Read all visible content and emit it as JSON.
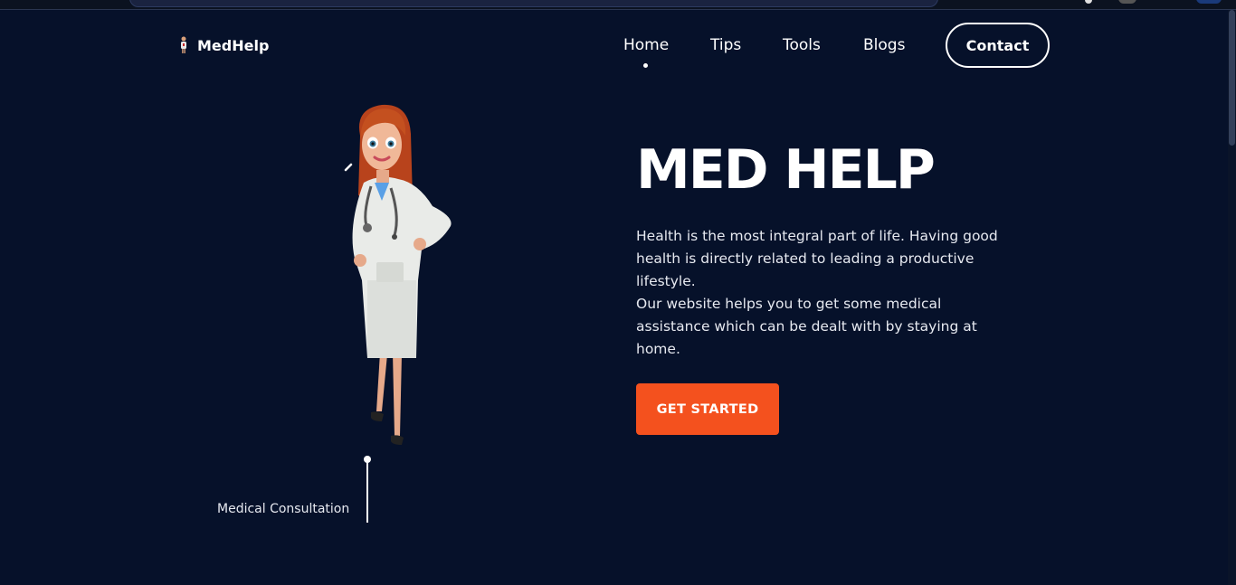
{
  "brand": {
    "name": "MedHelp"
  },
  "nav": {
    "items": [
      {
        "label": "Home"
      },
      {
        "label": "Tips"
      },
      {
        "label": "Tools"
      },
      {
        "label": "Blogs"
      }
    ],
    "active": "Home",
    "contact_label": "Contact"
  },
  "hero": {
    "title": "MED HELP",
    "paragraph_1": "Health is the most integral part of life. Having good health is directly related to leading a productive lifestyle.",
    "paragraph_2": "Our website helps you to get some medical assistance which can be dealt with by staying at home.",
    "cta_label": "GET STARTED"
  },
  "illustration": {
    "label": "Medical Consultation",
    "icon": "doctor-illustration"
  },
  "colors": {
    "background": "#06112a",
    "accent": "#f4511e",
    "text": "#ffffff"
  }
}
